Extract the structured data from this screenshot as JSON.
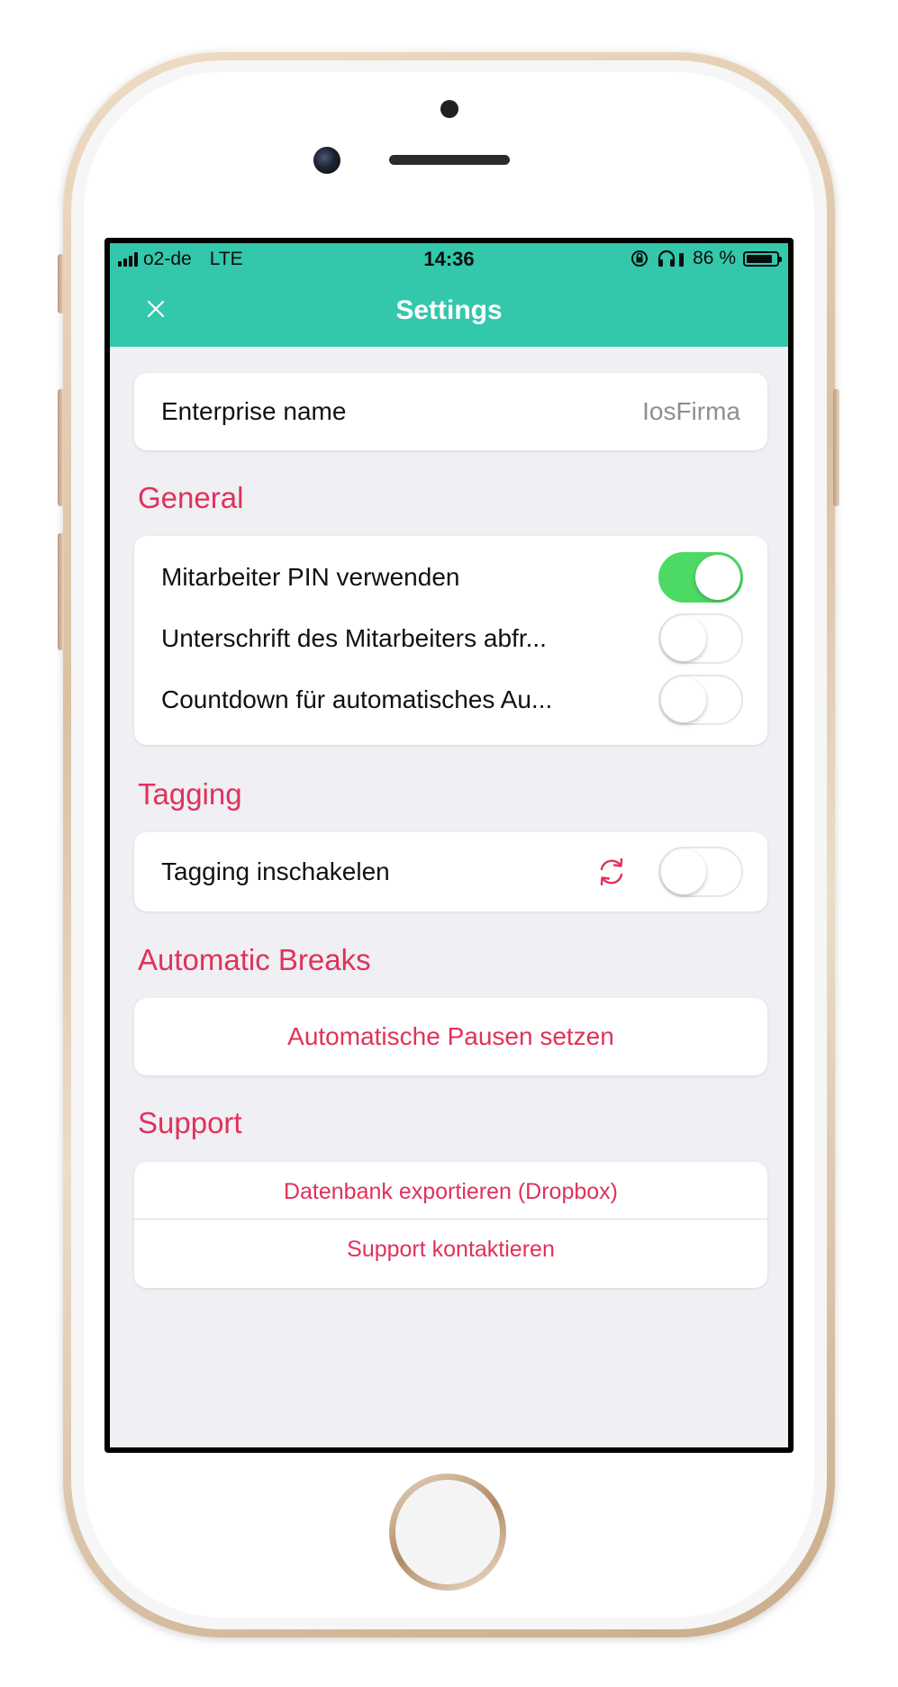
{
  "status_bar": {
    "carrier": "o2-de",
    "network": "LTE",
    "time": "14:36",
    "battery": "86 %",
    "battery_level": 0.86
  },
  "nav": {
    "title": "Settings",
    "close_icon": "close-icon"
  },
  "enterprise": {
    "label": "Enterprise name",
    "value": "IosFirma"
  },
  "general": {
    "title": "General",
    "items": [
      {
        "label": "Mitarbeiter PIN verwenden",
        "on": true
      },
      {
        "label": "Unterschrift des Mitarbeiters abfr...",
        "on": false
      },
      {
        "label": "Countdown für automatisches Au...",
        "on": false
      }
    ]
  },
  "tagging": {
    "title": "Tagging",
    "item_label": "Tagging inschakelen",
    "on": false,
    "icon": "refresh-icon"
  },
  "automatic_breaks": {
    "title": "Automatic Breaks",
    "button_label": "Automatische Pausen setzen"
  },
  "support": {
    "title": "Support",
    "export_label": "Datenbank exportieren (Dropbox)",
    "contact_label": "Support kontaktieren"
  },
  "colors": {
    "header": "#33c7ab",
    "accent": "#e0325a",
    "toggle_on": "#4cd964",
    "background": "#efeff4"
  }
}
